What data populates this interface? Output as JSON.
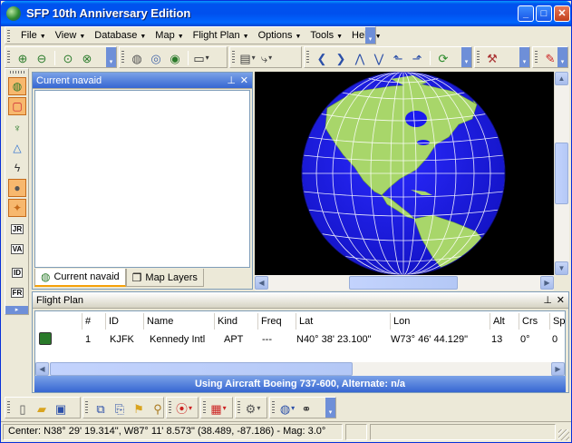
{
  "window": {
    "title": "SFP 10th Anniversary Edition",
    "minimize": "_",
    "maximize": "□",
    "close": "✕"
  },
  "menu": [
    "File",
    "View",
    "Database",
    "Map",
    "Flight Plan",
    "Options",
    "Tools",
    "Help"
  ],
  "toolbar_main": {
    "icons": [
      "zoom-in-icon",
      "zoom-out-icon",
      "zoom-extent-icon",
      "zoom-select-icon",
      "globe-grey-icon",
      "globe-grid-icon",
      "globe-color-icon",
      "map-frame-icon",
      "document-icon",
      "route-icon",
      "arrow-left-icon",
      "arrow-right-icon",
      "arrow-up-icon",
      "arrow-down-icon",
      "arrow-upleft-icon",
      "arrow-upright-icon",
      "refresh-icon",
      "tool-icon",
      "pen-icon"
    ]
  },
  "toolbar_bottom": {
    "icons": [
      "new-file-icon",
      "open-folder-icon",
      "save-icon",
      "copy-icon",
      "paste-icon",
      "flag-icon",
      "magic-wand-icon",
      "waypoint-icon",
      "chart-icon",
      "gear-icon",
      "globe-icon",
      "binoculars-icon"
    ]
  },
  "left_toolbar": {
    "buttons": [
      {
        "name": "globe-button",
        "glyph": "◍",
        "on": true
      },
      {
        "name": "airport-button",
        "glyph": "▢",
        "on": true
      },
      {
        "name": "antenna-button",
        "glyph": "♆",
        "on": false
      },
      {
        "name": "triangle-button",
        "glyph": "△",
        "on": false
      },
      {
        "name": "lightning-button",
        "glyph": "ϟ",
        "on": false
      },
      {
        "name": "planet-button",
        "glyph": "●",
        "on": true
      },
      {
        "name": "star-button",
        "glyph": "✦",
        "on": true
      },
      {
        "name": "jr-button",
        "glyph": "JR",
        "on": false
      },
      {
        "name": "va-button",
        "glyph": "VA",
        "on": false
      },
      {
        "name": "id-button",
        "glyph": "ID",
        "on": false
      },
      {
        "name": "fr-button",
        "glyph": "FR",
        "on": false
      }
    ]
  },
  "navaid_panel": {
    "title": "Current navaid",
    "pin": "⊥",
    "close": "✕",
    "tabs": [
      "Current navaid",
      "Map Layers"
    ]
  },
  "flight_plan": {
    "title": "Flight Plan",
    "pin": "⊥",
    "close": "✕",
    "columns": [
      "#",
      "ID",
      "Name",
      "Kind",
      "Freq",
      "Lat",
      "Lon",
      "Alt",
      "Crs",
      "Sp"
    ],
    "rows": [
      {
        "num": "1",
        "id": "KJFK",
        "name": "Kennedy Intl",
        "kind": "APT",
        "freq": "---",
        "lat": "N40° 38'  23.100\"",
        "lon": "W73° 46'  44.129\"",
        "alt": "13",
        "crs": "0°",
        "sp": "0"
      }
    ],
    "status": "Using Aircraft Boeing 737-600, Alternate: n/a"
  },
  "status_bar": {
    "text": "Center: N38° 29'  19.314\", W87° 11'  8.573\" (38.489, -87.186) - Mag: 3.0°"
  },
  "map": {
    "ocean_color": "#1a1aee",
    "land_color": "#a8d66a",
    "grid_color": "#ffffff"
  }
}
